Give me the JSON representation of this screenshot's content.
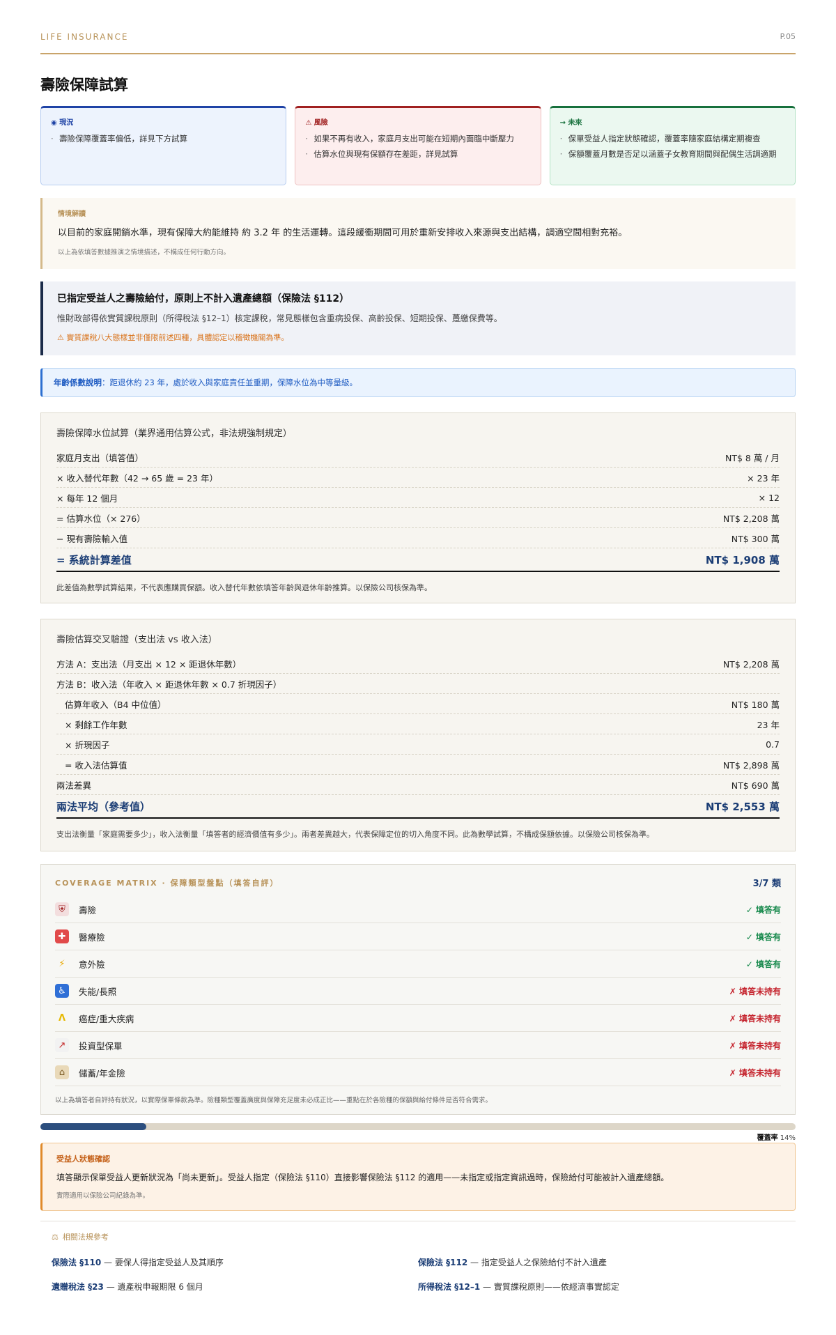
{
  "header": {
    "brand": "LIFE INSURANCE",
    "page": "P.05"
  },
  "title": "壽險保障試算",
  "cards": {
    "now": {
      "icon": "◉",
      "label": "現況",
      "items": [
        "壽險保障覆蓋率偏低，詳見下方試算"
      ]
    },
    "risk": {
      "icon": "⚠",
      "label": "風險",
      "items": [
        "如果不再有收入，家庭月支出可能在短期內面臨中斷壓力",
        "估算水位與現有保額存在差距，詳見試算"
      ]
    },
    "future": {
      "icon": "→",
      "label": "未來",
      "items": [
        "保單受益人指定狀態確認，覆蓋率隨家庭結構定期複查",
        "保額覆蓋月數是否足以涵蓋子女教育期間與配偶生活調適期"
      ]
    }
  },
  "scenario": {
    "label": "情境解讀",
    "text": "以目前的家庭開銷水準，現有保障大約能維持 約 3.2 年 的生活運轉。這段緩衝期間可用於重新安排收入來源與支出結構，調適空間相對充裕。",
    "note": "以上為依填答數據推演之情境描述，不構成任何行動方向。"
  },
  "estate": {
    "heading": "已指定受益人之壽險給付，原則上不計入遺產總額（保險法 §112）",
    "para": "惟財政部得依實質課稅原則（所得稅法 §12–1）核定課稅，常見態樣包含重病投保、高齡投保、短期投保、躉繳保費等。",
    "warning": "⚠ 實質課稅八大態樣並非僅限前述四種，具體認定以稽徵機關為準。"
  },
  "age": {
    "label": "年齡係數說明",
    "text": "：距退休約 23 年，處於收入與家庭責任並重期，保障水位為中等量級。"
  },
  "calc1": {
    "title": "壽險保障水位試算（業界通用估算公式，非法規強制規定）",
    "rows": [
      {
        "label": "家庭月支出（填答值）",
        "value": "NT$ 8 萬 / 月"
      },
      {
        "label": "× 收入替代年數（42 → 65 歲 = 23 年）",
        "value": "× 23 年"
      },
      {
        "label": "× 每年 12 個月",
        "value": "× 12"
      },
      {
        "label": "= 估算水位（× 276）",
        "value": "NT$ 2,208 萬"
      },
      {
        "label": "− 現有壽險輸入值",
        "value": "NT$ 300 萬"
      }
    ],
    "total": {
      "label": "= 系統計算差值",
      "value": "NT$ 1,908 萬"
    },
    "foot": "此差值為數學試算結果，不代表應購買保額。收入替代年數依填答年齡與退休年齡推算。以保險公司核保為準。"
  },
  "calc2": {
    "title": "壽險估算交叉驗證（支出法 vs 收入法）",
    "rows": [
      {
        "label": "方法 A：支出法（月支出 × 12 × 距退休年數）",
        "value": "NT$ 2,208 萬"
      },
      {
        "label": "方法 B：收入法（年收入 × 距退休年數 × 0.7 折現因子）",
        "value": ""
      },
      {
        "label": "估算年收入（B4 中位值）",
        "value": "NT$ 180 萬"
      },
      {
        "label": "× 剩餘工作年數",
        "value": "23 年"
      },
      {
        "label": "× 折現因子",
        "value": "0.7"
      },
      {
        "label": "= 收入法估算值",
        "value": "NT$ 2,898 萬"
      },
      {
        "label": "兩法差異",
        "value": "NT$ 690 萬"
      }
    ],
    "total": {
      "label": "兩法平均（參考值）",
      "value": "NT$ 2,553 萬"
    },
    "foot": "支出法衡量「家庭需要多少」，收入法衡量「填答者的經濟價值有多少」。兩者差異越大，代表保障定位的切入角度不同。此為數學試算，不構成保額依據。以保險公司核保為準。"
  },
  "matrix": {
    "label": "COVERAGE MATRIX · 保障類型盤點（填答自評）",
    "count": "3/7 類",
    "items": [
      {
        "icon": "shield-icon",
        "glyph": "⛨",
        "name": "壽險",
        "status": "✓ 填答有",
        "has": true
      },
      {
        "icon": "hospital-icon",
        "glyph": "✚",
        "name": "醫療險",
        "status": "✓ 填答有",
        "has": true
      },
      {
        "icon": "lightning-icon",
        "glyph": "⚡",
        "name": "意外險",
        "status": "✓ 填答有",
        "has": true
      },
      {
        "icon": "wheelchair-icon",
        "glyph": "♿",
        "name": "失能/長照",
        "status": "✗ 填答未持有",
        "has": false
      },
      {
        "icon": "ribbon-icon",
        "glyph": "ᐱ",
        "name": "癌症/重大疾病",
        "status": "✗ 填答未持有",
        "has": false
      },
      {
        "icon": "chart-icon",
        "glyph": "↗",
        "name": "投資型保單",
        "status": "✗ 填答未持有",
        "has": false
      },
      {
        "icon": "bank-icon",
        "glyph": "⌂",
        "name": "儲蓄/年金險",
        "status": "✗ 填答未持有",
        "has": false
      }
    ],
    "note": "以上為填答者自評持有狀況，以實際保單條款為準。險種類型覆蓋廣度與保障充足度未必成正比——重點在於各險種的保額與給付條件是否符合需求。"
  },
  "coverage": {
    "label": "覆蓋率",
    "percent": 14,
    "percent_text": "14%"
  },
  "beneficiary": {
    "title": "受益人狀態確認",
    "text": "填答顯示保單受益人更新狀況為「尚未更新」。受益人指定（保險法 §110）直接影響保險法 §112 的適用——未指定或指定資訊過時，保險給付可能被計入遺產總額。",
    "note": "實際適用以保險公司紀錄為準。"
  },
  "laws": {
    "heading": "相關法規參考",
    "items": [
      {
        "key": "保險法 §110",
        "desc": " — 要保人得指定受益人及其順序"
      },
      {
        "key": "保險法 §112",
        "desc": " — 指定受益人之保險給付不計入遺產"
      },
      {
        "key": "遺贈稅法 §23",
        "desc": " — 遺產稅申報期限 6 個月"
      },
      {
        "key": "所得稅法 §12–1",
        "desc": " — 實質課稅原則——依經濟事實認定"
      }
    ]
  },
  "colors": {
    "gold": "#b8935a",
    "navy": "#1b3d75",
    "green": "#14884a",
    "red": "#c4202a"
  }
}
